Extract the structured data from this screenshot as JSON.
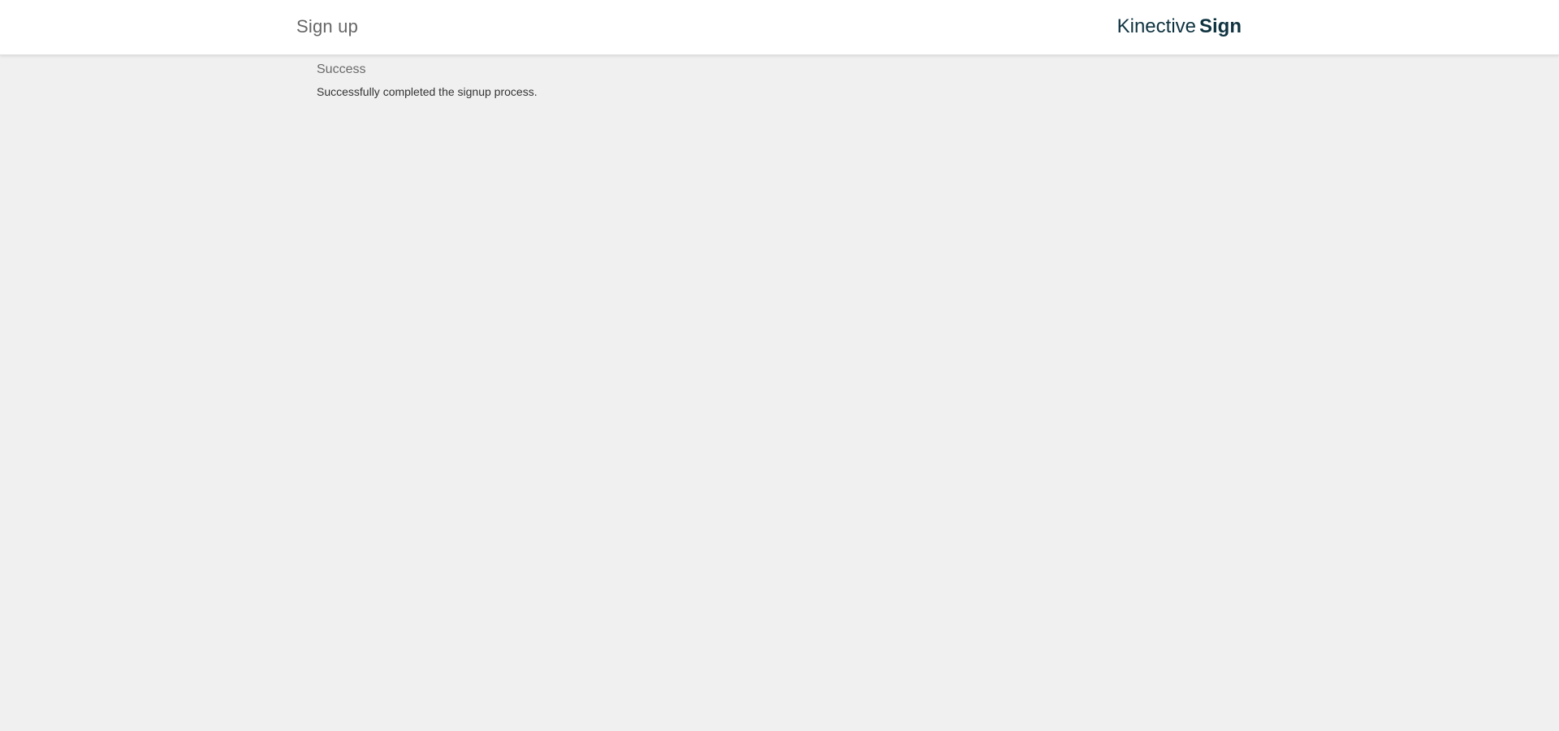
{
  "header": {
    "title": "Sign up",
    "brand": {
      "light": "Kinective",
      "bold": "Sign"
    }
  },
  "content": {
    "heading": "Success",
    "message": "Successfully completed the signup process."
  },
  "colors": {
    "background": "#f0f0f0",
    "header_background": "#ffffff",
    "brand": "#0f3340"
  }
}
